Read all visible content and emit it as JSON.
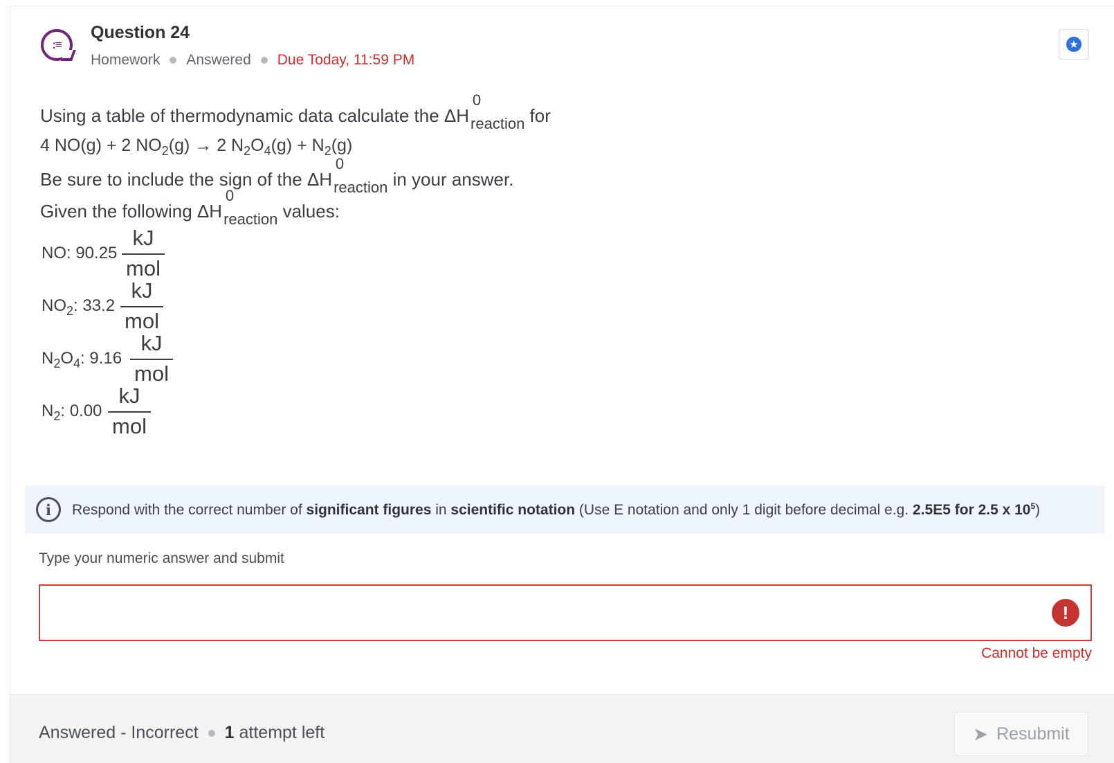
{
  "question": {
    "title": "Question 24",
    "type": "Homework",
    "status": "Answered",
    "due": "Due Today, 11:59 PM"
  },
  "stem": {
    "line1_prefix": "Using a table of thermodynamic data calculate the ",
    "delta_h": "ΔH",
    "superscript": "0",
    "subscript": "reaction",
    "line1_suffix": " for",
    "equation": {
      "r1": "4 NO(g) + 2 NO",
      "r1_sub": "2",
      "r2": "(g) → 2 N",
      "r2_sub": "2",
      "r3": "O",
      "r3_sub": "4",
      "r4": "(g) + N",
      "r4_sub": "2",
      "r5": "(g)"
    },
    "line3_prefix": "Be sure to include the sign of the ",
    "line3_suffix": " in your answer.",
    "line4_prefix": "Given the following ",
    "line4_suffix": " values:"
  },
  "values": [
    {
      "species": "NO",
      "sub": "",
      "suffix": ": 90.25",
      "num": "kJ",
      "den": "mol"
    },
    {
      "species": "NO",
      "sub": "2",
      "suffix": ": 33.2",
      "num": "kJ",
      "den": "mol"
    },
    {
      "species": "N",
      "sub": "2",
      "species2": "O",
      "sub2": "4",
      "suffix": ": 9.16",
      "num": "kJ",
      "den": "mol"
    },
    {
      "species": "N",
      "sub": "2",
      "suffix": ": 0.00",
      "num": "kJ",
      "den": "mol"
    }
  ],
  "info": {
    "icon": "info-icon",
    "t1": "Respond with the correct number of ",
    "b1": "significant figures",
    "t2": " in ",
    "b2": "scientific notation",
    "t3": " (Use E notation and only 1 digit before decimal e.g. ",
    "b3": "2.5E5 for 2.5 x 10",
    "b3_sup": "5",
    "t4": ")"
  },
  "answer": {
    "label": "Type your numeric answer and submit",
    "value": "",
    "placeholder": "",
    "error_icon": "!",
    "error": "Cannot be empty"
  },
  "footer": {
    "status": "Answered - Incorrect",
    "attempts_num": "1",
    "attempts_text": " attempt left",
    "resubmit": "Resubmit"
  },
  "colors": {
    "accent": "#2f6fdc",
    "error": "#cc2e2e",
    "icon_purple": "#6b2a7a"
  }
}
